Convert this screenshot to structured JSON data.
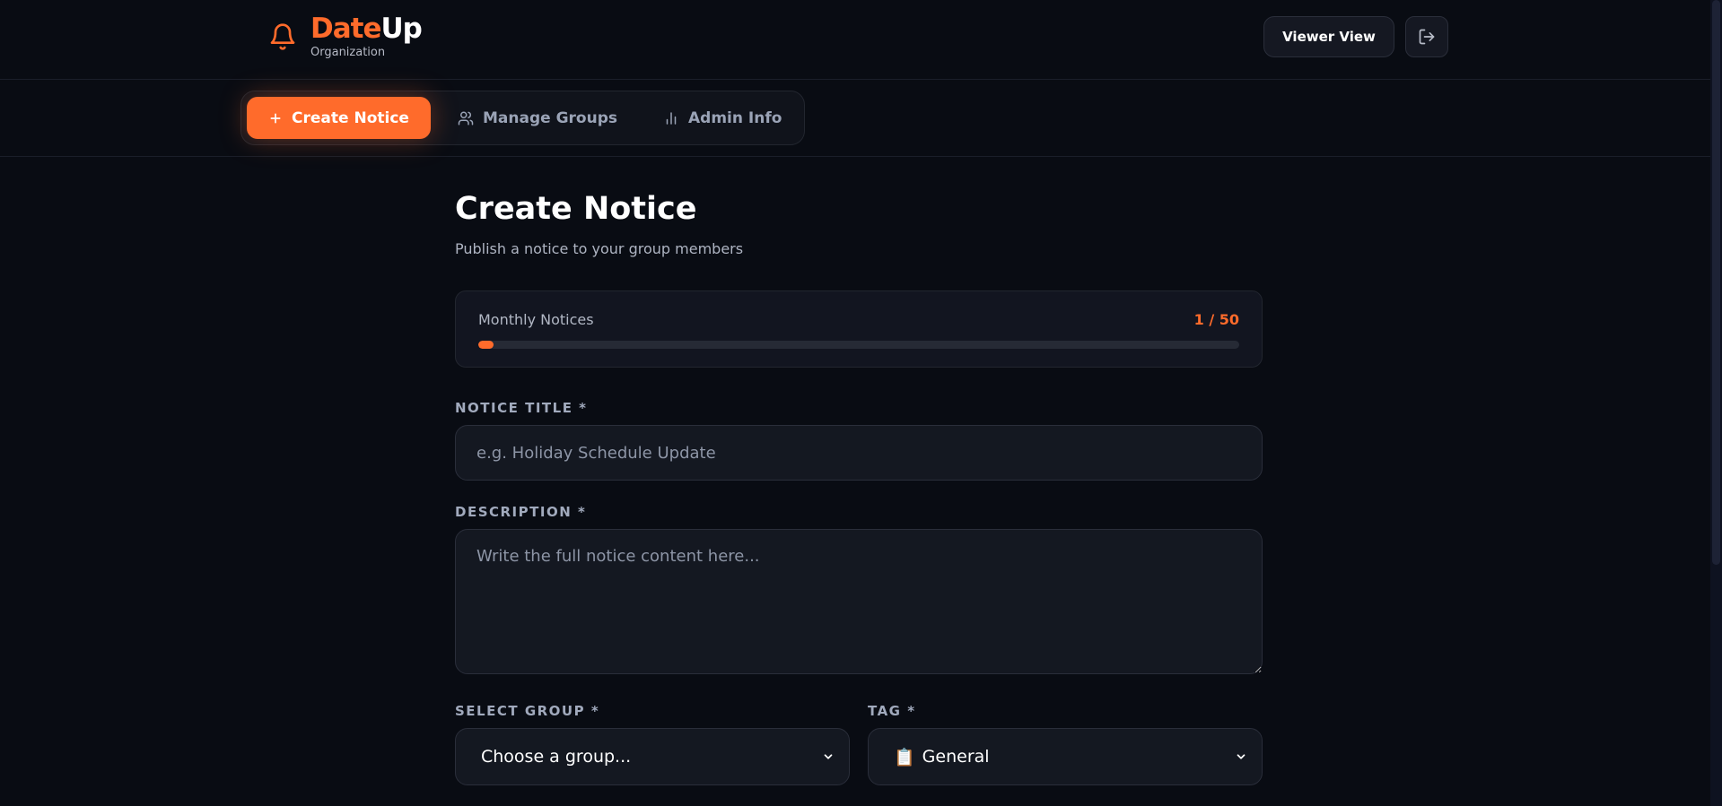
{
  "header": {
    "brand_part1": "Date",
    "brand_part2": "Up",
    "brand_sub": "Organization",
    "viewer_label": "Viewer View",
    "icons": {
      "brand": "bell-icon",
      "logout": "logout-icon"
    }
  },
  "nav": {
    "tabs": [
      {
        "label": "Create Notice",
        "icon": "plus-icon",
        "active": true
      },
      {
        "label": "Manage Groups",
        "icon": "users-icon",
        "active": false
      },
      {
        "label": "Admin Info",
        "icon": "bar-chart-icon",
        "active": false
      }
    ]
  },
  "main": {
    "title": "Create Notice",
    "subtitle": "Publish a notice to your group members",
    "quota": {
      "label": "Monthly Notices",
      "value_text": "1 / 50",
      "used": 1,
      "limit": 50
    },
    "title_field": {
      "label": "NOTICE TITLE *",
      "placeholder": "e.g. Holiday Schedule Update"
    },
    "description_field": {
      "label": "DESCRIPTION *",
      "placeholder": "Write the full notice content here..."
    },
    "group_field": {
      "label": "SELECT GROUP *",
      "selected": "Choose a group..."
    },
    "tag_field": {
      "label": "TAG *",
      "emoji": "📋",
      "selected": "General"
    }
  },
  "colors": {
    "accent": "#ff6b2b",
    "background": "#090c13",
    "surface": "#141821"
  }
}
